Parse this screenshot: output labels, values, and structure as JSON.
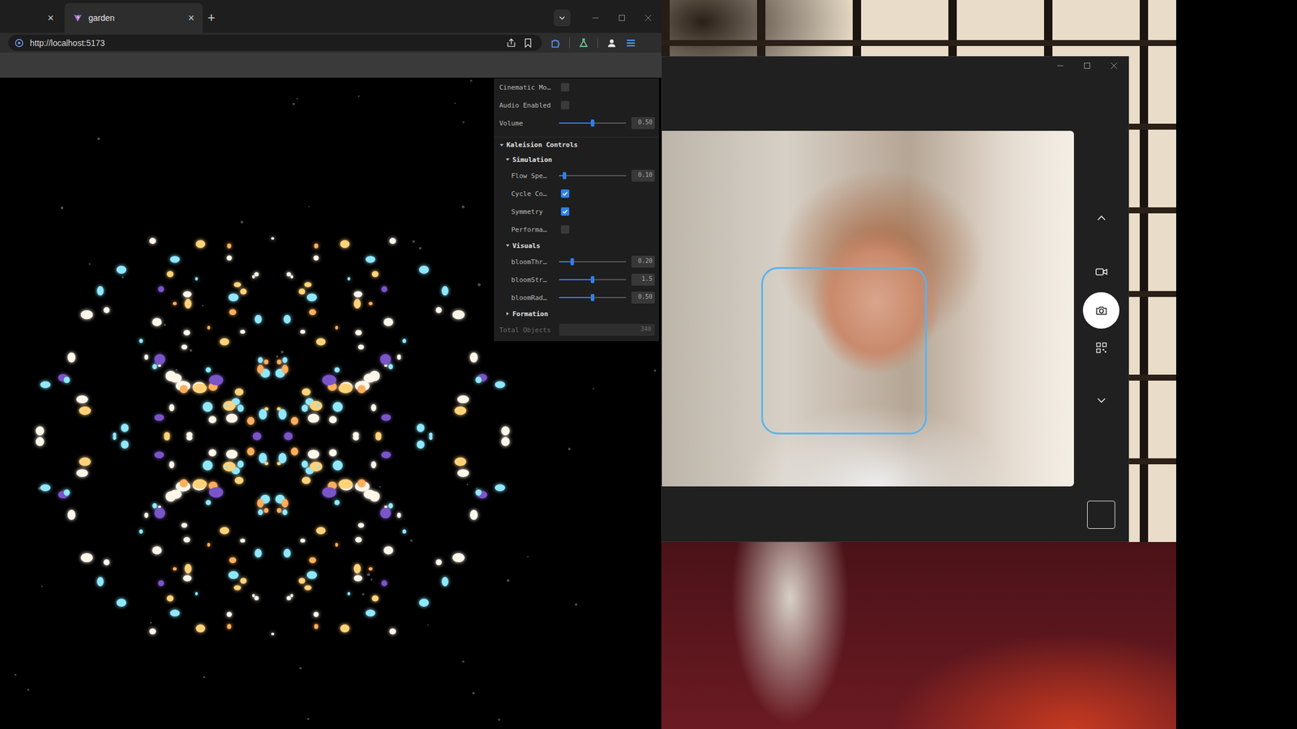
{
  "browser": {
    "tabs": [
      {
        "close": "×",
        "selected": false
      },
      {
        "label": "garden",
        "close": "×",
        "selected": true
      }
    ],
    "new_tab": "+",
    "url": "http://localhost:5173"
  },
  "controls": {
    "rows": [
      {
        "kind": "checkbox",
        "label": "Cinematic Mo…",
        "checked": false
      },
      {
        "kind": "checkbox",
        "label": "Audio Enabled",
        "checked": false
      },
      {
        "kind": "slider",
        "label": "Volume",
        "level": 0.5,
        "reading": "0.50"
      },
      {
        "kind": "folder",
        "label": "Kaleision Controls",
        "expanded": true,
        "children": [
          {
            "kind": "folder",
            "label": "Simulation",
            "expanded": true,
            "children": [
              {
                "kind": "slider",
                "label": "Flow Spe…",
                "level": 0.08,
                "reading": "0.10"
              },
              {
                "kind": "checkbox",
                "label": "Cycle Co…",
                "checked": true
              },
              {
                "kind": "checkbox",
                "label": "Symmetry",
                "checked": true
              },
              {
                "kind": "checkbox",
                "label": "Performa…",
                "checked": false
              }
            ]
          },
          {
            "kind": "folder",
            "label": "Visuals",
            "expanded": true,
            "children": [
              {
                "kind": "slider",
                "label": "bloomThr…",
                "level": 0.2,
                "reading": "0.20"
              },
              {
                "kind": "slider",
                "label": "bloomStr…",
                "level": 0.5,
                "reading": "1.5"
              },
              {
                "kind": "slider",
                "label": "bloomRad…",
                "level": 0.5,
                "reading": "0.50"
              }
            ]
          },
          {
            "kind": "folder",
            "label": "Formation",
            "expanded": false,
            "children": []
          }
        ]
      },
      {
        "kind": "text",
        "label": "Total Objects",
        "value": "340",
        "disabled": true
      }
    ]
  },
  "camera": {
    "face_detected": true,
    "modes": [
      {
        "kind": "video",
        "selected": false
      },
      {
        "kind": "photo",
        "selected": true
      }
    ]
  }
}
